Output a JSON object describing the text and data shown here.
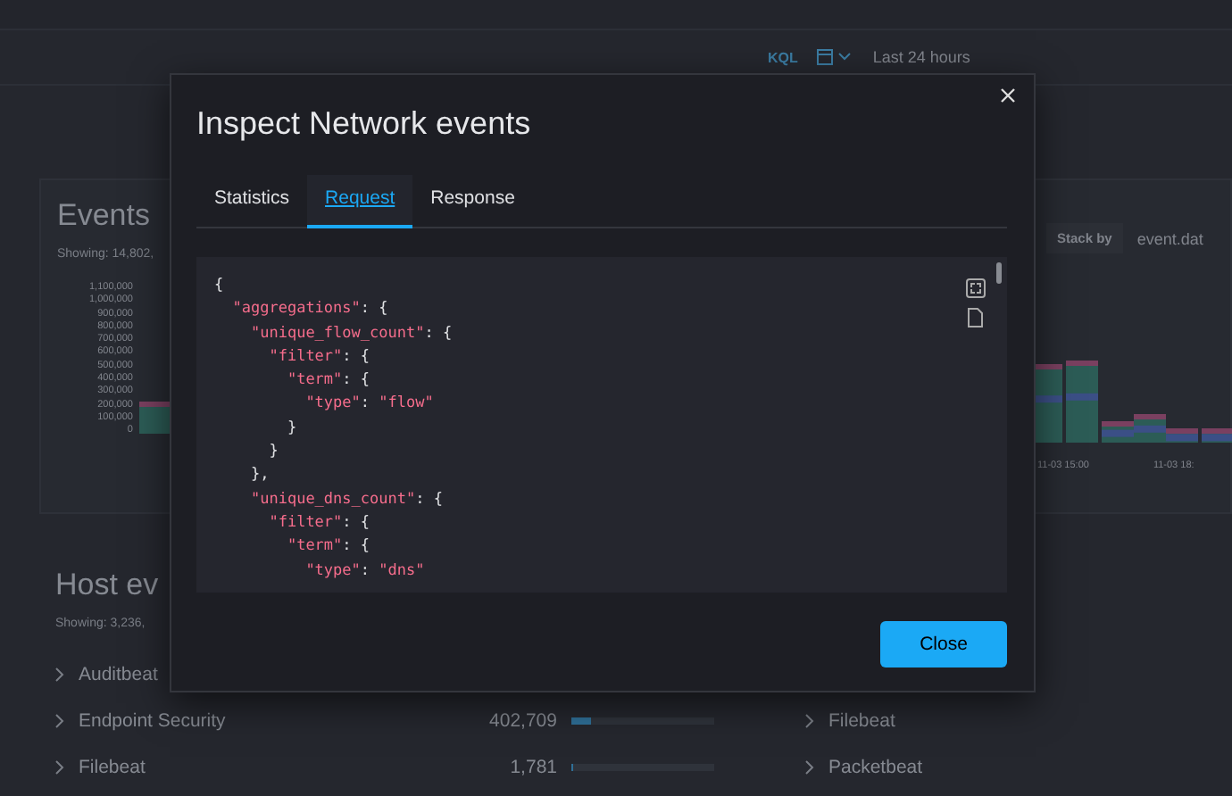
{
  "top_bar": {
    "query_language": "KQL",
    "time_range": "Last 24 hours"
  },
  "events_panel": {
    "title": "Events",
    "subtitle": "Showing: 14,802,",
    "y_axis_labels": [
      "1,100,000",
      "1,000,000",
      "900,000",
      "800,000",
      "700,000",
      "600,000",
      "500,000",
      "400,000",
      "300,000",
      "200,000",
      "100,000",
      "0"
    ],
    "stack_by_label": "Stack by",
    "stack_by_value": "event.dat",
    "x_axis_labels": [
      "11-03 15:00",
      "11-03 18:"
    ]
  },
  "host_panel": {
    "title": "Host ev",
    "subtitle": "Showing: 3,236,",
    "rows_left": [
      {
        "name": "Auditbeat"
      },
      {
        "name": "Endpoint Security",
        "count": "402,709",
        "level": 0.14
      },
      {
        "name": "Filebeat",
        "count": "1,781",
        "level": 0.01
      }
    ],
    "rows_right": [
      {
        "name": "Filebeat"
      },
      {
        "name": "Packetbeat"
      }
    ]
  },
  "modal": {
    "title": "Inspect Network events",
    "tabs": [
      {
        "label": "Statistics",
        "selected": false
      },
      {
        "label": "Request",
        "selected": true
      },
      {
        "label": "Response",
        "selected": false
      }
    ],
    "code_lines": [
      "{",
      "  \"aggregations\": {",
      "    \"unique_flow_count\": {",
      "      \"filter\": {",
      "        \"term\": {",
      "          \"type\": \"flow\"",
      "        }",
      "      }",
      "    },",
      "    \"unique_dns_count\": {",
      "      \"filter\": {",
      "        \"term\": {",
      "          \"type\": \"dns\""
    ],
    "close_button": "Close"
  }
}
